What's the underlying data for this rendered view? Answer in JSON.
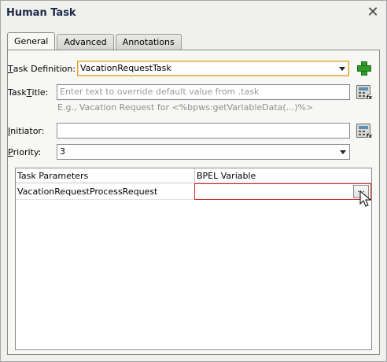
{
  "dialog": {
    "title": "Human Task",
    "close_icon": "close-icon"
  },
  "tabs": [
    {
      "label": "General",
      "active": true
    },
    {
      "label": "Advanced",
      "active": false
    },
    {
      "label": "Annotations",
      "active": false
    }
  ],
  "form": {
    "task_definition": {
      "label_first": "T",
      "label_rest": "ask Definition:",
      "value": "VacationRequestTask"
    },
    "task_title": {
      "label_first": "Task ",
      "label_mid": "T",
      "label_rest": "itle:",
      "placeholder": "Enter text to override default value from .task",
      "hint": "E.g., Vacation Request for <%bpws:getVariableData(...)%>"
    },
    "initiator": {
      "label_first": "I",
      "label_rest": "nitiator:",
      "value": ""
    },
    "priority": {
      "label_first": "P",
      "label_rest": "riority:",
      "value": "3"
    }
  },
  "table": {
    "columns": [
      "Task Parameters",
      "BPEL Variable"
    ],
    "rows": [
      {
        "parameter": "VacationRequestProcessRequest",
        "variable": ""
      }
    ],
    "browse_label": "..."
  },
  "colors": {
    "focus_border": "#e2a52f",
    "error_border": "#d22d2d",
    "add_green": "#2e9a28"
  }
}
